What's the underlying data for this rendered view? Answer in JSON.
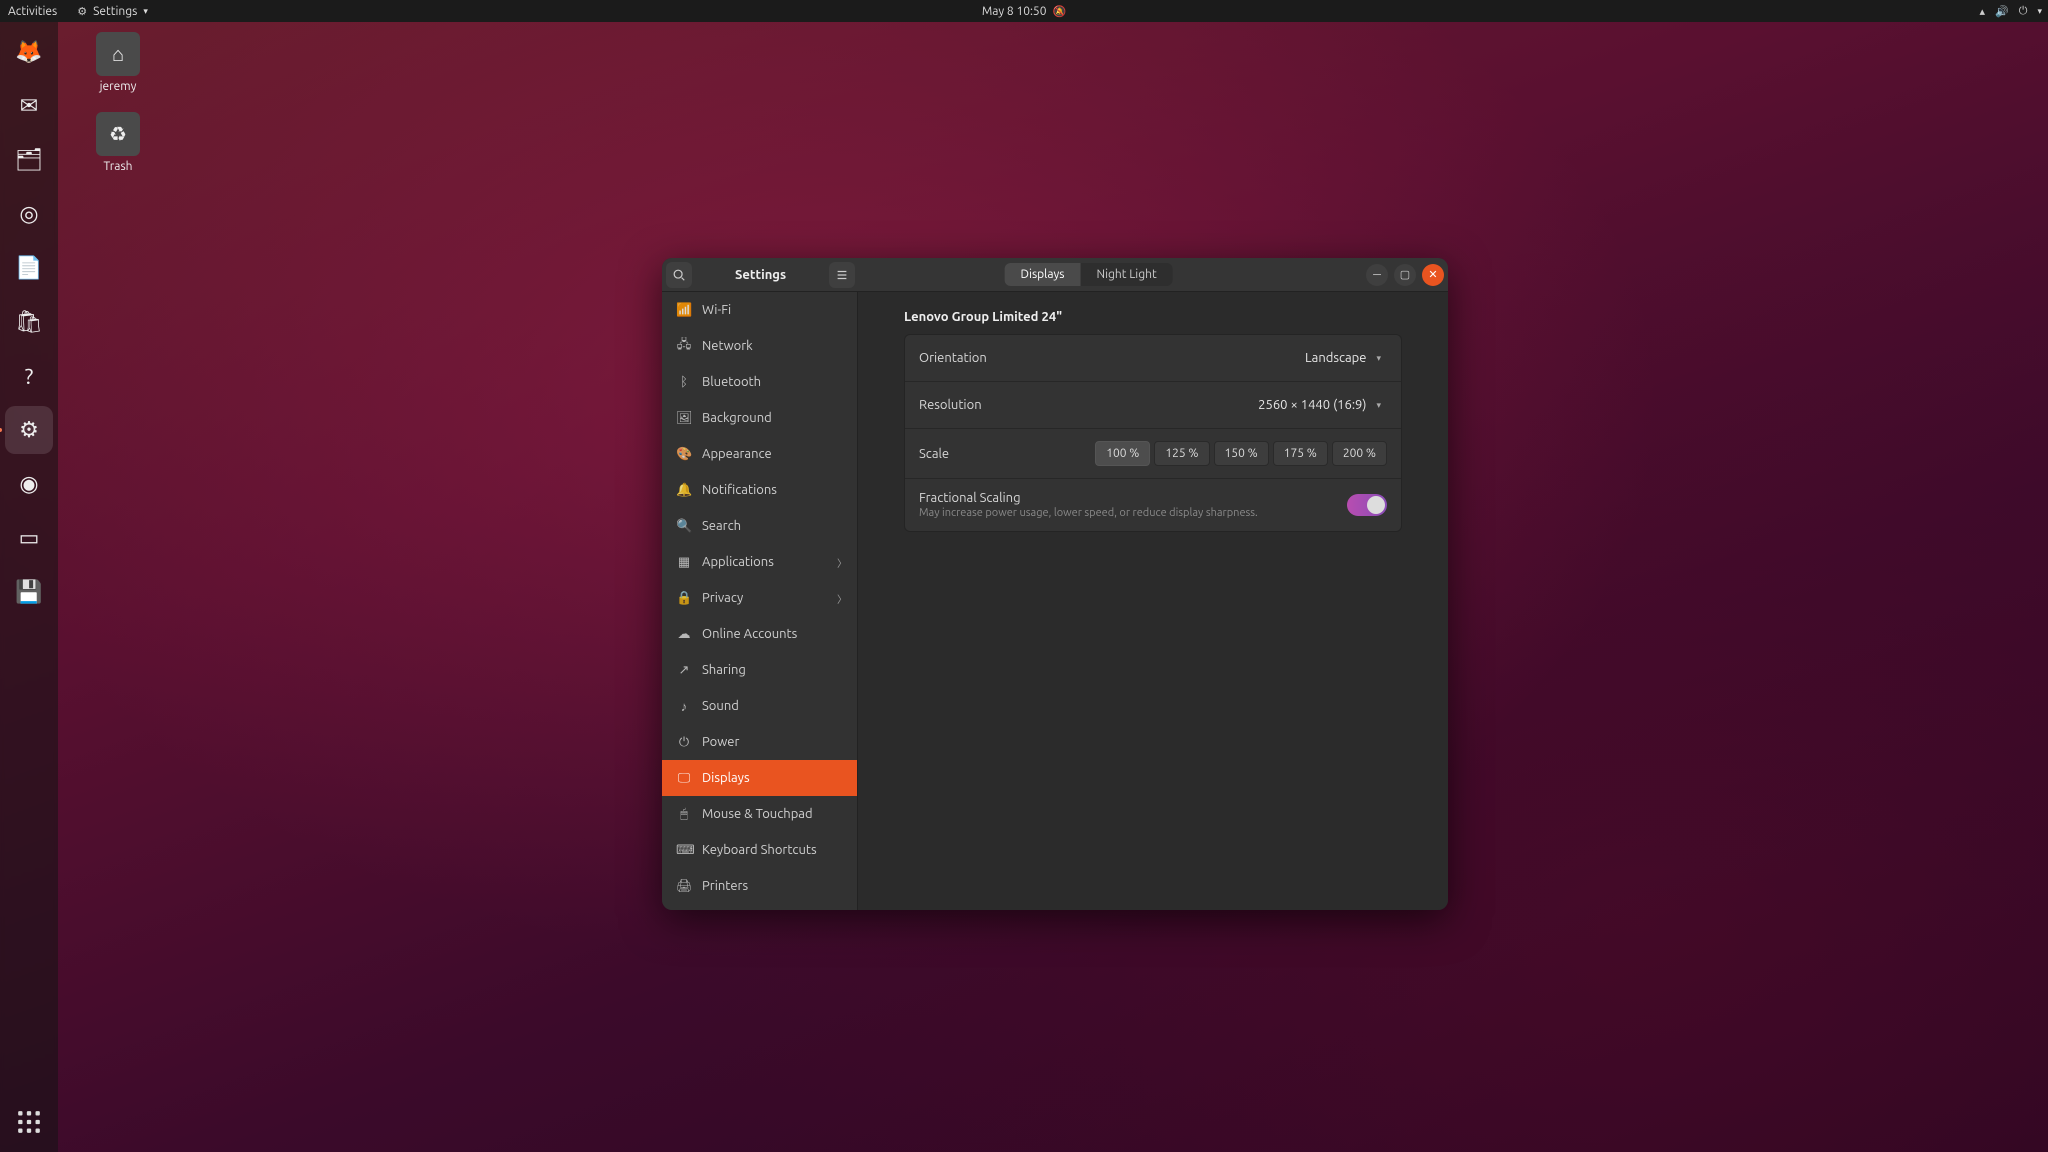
{
  "topbar": {
    "activities": "Activities",
    "app_indicator": "Settings",
    "clock": "May 8  10:50"
  },
  "desktop_icons": [
    {
      "name": "home",
      "label": "jeremy"
    },
    {
      "name": "trash",
      "label": "Trash"
    }
  ],
  "dock": [
    {
      "name": "firefox",
      "glyph": "🦊"
    },
    {
      "name": "thunderbird",
      "glyph": "✉"
    },
    {
      "name": "files",
      "glyph": "🗂"
    },
    {
      "name": "rhythmbox",
      "glyph": "◎"
    },
    {
      "name": "writer",
      "glyph": "📄"
    },
    {
      "name": "software",
      "glyph": "🛍"
    },
    {
      "name": "help",
      "glyph": "?"
    },
    {
      "name": "settings",
      "glyph": "⚙",
      "active": true,
      "running": true
    },
    {
      "name": "obs",
      "glyph": "◉"
    },
    {
      "name": "textedit",
      "glyph": "▭"
    },
    {
      "name": "diskutil",
      "glyph": "💾"
    }
  ],
  "window": {
    "title": "Settings",
    "tabs": {
      "displays": "Displays",
      "night_light": "Night Light",
      "active": "displays"
    }
  },
  "sidebar": [
    {
      "id": "wifi",
      "icon": "📶",
      "label": "Wi-Fi"
    },
    {
      "id": "network",
      "icon": "🖧",
      "label": "Network"
    },
    {
      "id": "bluetooth",
      "icon": "ᛒ",
      "label": "Bluetooth"
    },
    {
      "id": "background",
      "icon": "🖼",
      "label": "Background"
    },
    {
      "id": "appearance",
      "icon": "🎨",
      "label": "Appearance"
    },
    {
      "id": "notifications",
      "icon": "🔔",
      "label": "Notifications"
    },
    {
      "id": "search",
      "icon": "🔍",
      "label": "Search"
    },
    {
      "id": "applications",
      "icon": "▦",
      "label": "Applications",
      "chevron": true
    },
    {
      "id": "privacy",
      "icon": "🔒",
      "label": "Privacy",
      "chevron": true
    },
    {
      "id": "online-accounts",
      "icon": "☁",
      "label": "Online Accounts"
    },
    {
      "id": "sharing",
      "icon": "↗",
      "label": "Sharing"
    },
    {
      "id": "sound",
      "icon": "♪",
      "label": "Sound"
    },
    {
      "id": "power",
      "icon": "⏻",
      "label": "Power"
    },
    {
      "id": "displays",
      "icon": "🖵",
      "label": "Displays",
      "active": true
    },
    {
      "id": "mouse",
      "icon": "🖱",
      "label": "Mouse & Touchpad"
    },
    {
      "id": "keyboard",
      "icon": "⌨",
      "label": "Keyboard Shortcuts"
    },
    {
      "id": "printers",
      "icon": "🖨",
      "label": "Printers"
    }
  ],
  "displays": {
    "monitor_name": "Lenovo Group Limited 24\"",
    "orientation": {
      "label": "Orientation",
      "value": "Landscape"
    },
    "resolution": {
      "label": "Resolution",
      "value": "2560 × 1440 (16:9)"
    },
    "scale": {
      "label": "Scale",
      "options": [
        "100 %",
        "125 %",
        "150 %",
        "175 %",
        "200 %"
      ],
      "selected": "100 %"
    },
    "fractional": {
      "label": "Fractional Scaling",
      "sub": "May increase power usage, lower speed, or reduce display sharpness.",
      "on": true
    }
  }
}
